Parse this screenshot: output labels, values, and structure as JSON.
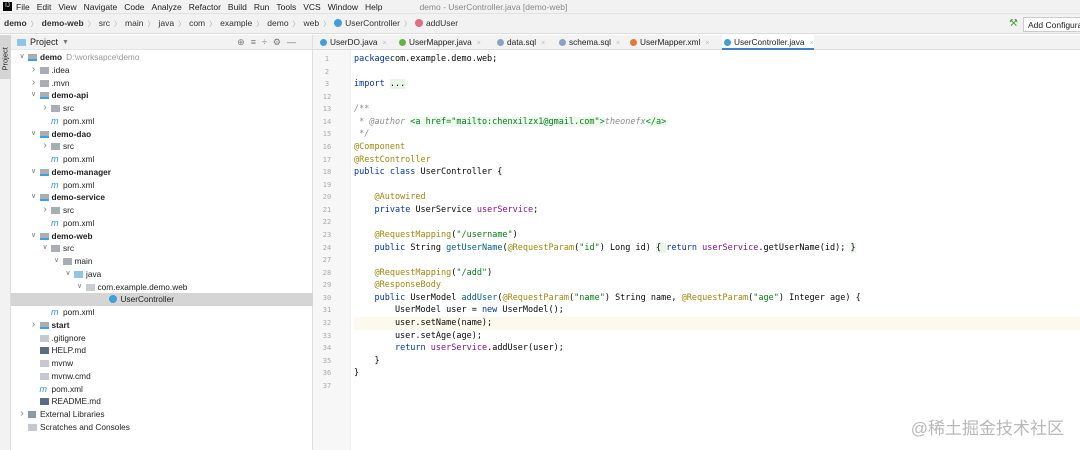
{
  "menubar": {
    "items": [
      "File",
      "Edit",
      "View",
      "Navigate",
      "Code",
      "Analyze",
      "Refactor",
      "Build",
      "Run",
      "Tools",
      "VCS",
      "Window",
      "Help"
    ],
    "title": "demo - UserController.java [demo-web]"
  },
  "breadcrumb": [
    "demo",
    "demo-web",
    "src",
    "main",
    "java",
    "com",
    "example",
    "demo",
    "web",
    "UserController",
    "addUser"
  ],
  "toolbar": {
    "add_config": "Add Configuration..."
  },
  "sidebar": {
    "vertical_tab": "Project",
    "panel_title": "Project"
  },
  "tree": [
    {
      "label": "demo",
      "hint": "D:\\worksapce\\demo",
      "level": 0,
      "arrow": "open",
      "icon": "mod",
      "bold": true
    },
    {
      "label": ".idea",
      "level": 1,
      "arrow": "closed",
      "icon": "dir"
    },
    {
      "label": ".mvn",
      "level": 1,
      "arrow": "closed",
      "icon": "dir"
    },
    {
      "label": "demo-api",
      "level": 1,
      "arrow": "open",
      "icon": "mod",
      "bold": true
    },
    {
      "label": "src",
      "level": 2,
      "arrow": "closed",
      "icon": "dir"
    },
    {
      "label": "pom.xml",
      "level": 2,
      "icon": "xml"
    },
    {
      "label": "demo-dao",
      "level": 1,
      "arrow": "open",
      "icon": "mod",
      "bold": true
    },
    {
      "label": "src",
      "level": 2,
      "arrow": "closed",
      "icon": "dir"
    },
    {
      "label": "pom.xml",
      "level": 2,
      "icon": "xml"
    },
    {
      "label": "demo-manager",
      "level": 1,
      "arrow": "open",
      "icon": "mod",
      "bold": true
    },
    {
      "label": "pom.xml",
      "level": 2,
      "icon": "xml"
    },
    {
      "label": "demo-service",
      "level": 1,
      "arrow": "open",
      "icon": "mod",
      "bold": true
    },
    {
      "label": "src",
      "level": 2,
      "arrow": "closed",
      "icon": "dir"
    },
    {
      "label": "pom.xml",
      "level": 2,
      "icon": "xml"
    },
    {
      "label": "demo-web",
      "level": 1,
      "arrow": "open",
      "icon": "mod",
      "bold": true
    },
    {
      "label": "src",
      "level": 2,
      "arrow": "open",
      "icon": "dir"
    },
    {
      "label": "main",
      "level": 3,
      "arrow": "open",
      "icon": "dir"
    },
    {
      "label": "java",
      "level": 4,
      "arrow": "open",
      "icon": "src"
    },
    {
      "label": "com.example.demo.web",
      "level": 5,
      "arrow": "open",
      "icon": "pkg"
    },
    {
      "label": "UserController",
      "level": 7,
      "icon": "cls",
      "selected": true
    },
    {
      "label": "pom.xml",
      "level": 2,
      "icon": "xml"
    },
    {
      "label": "start",
      "level": 1,
      "arrow": "closed",
      "icon": "mod",
      "bold": true
    },
    {
      "label": ".gitignore",
      "level": 1,
      "icon": "file"
    },
    {
      "label": "HELP.md",
      "level": 1,
      "icon": "md"
    },
    {
      "label": "mvnw",
      "level": 1,
      "icon": "file"
    },
    {
      "label": "mvnw.cmd",
      "level": 1,
      "icon": "file"
    },
    {
      "label": "pom.xml",
      "level": 1,
      "icon": "xml"
    },
    {
      "label": "README.md",
      "level": 1,
      "icon": "md"
    },
    {
      "label": "External Libraries",
      "level": 0,
      "arrow": "closed",
      "icon": "lib"
    },
    {
      "label": "Scratches and Consoles",
      "level": 0,
      "icon": "file"
    }
  ],
  "tabs": [
    {
      "label": "UserDO.java",
      "color": "#3f9fd6"
    },
    {
      "label": "UserMapper.java",
      "color": "#62b543"
    },
    {
      "label": "data.sql",
      "color": "#8aa4c0"
    },
    {
      "label": "schema.sql",
      "color": "#8aa4c0"
    },
    {
      "label": "UserMapper.xml",
      "color": "#e07a3a"
    },
    {
      "label": "UserController.java",
      "color": "#3f9fd6",
      "active": true
    }
  ],
  "code": [
    {
      "n": "1",
      "s": [
        [
          "kw",
          "package"
        ],
        [
          "",
          "com.example.demo.web;"
        ]
      ]
    },
    {
      "n": "2",
      "s": []
    },
    {
      "n": "3",
      "s": [
        [
          "kw",
          "import"
        ],
        [
          "",
          " "
        ],
        [
          "fo",
          "..."
        ]
      ]
    },
    {
      "n": "12",
      "s": []
    },
    {
      "n": "13",
      "s": [
        [
          "cm",
          "/**"
        ]
      ]
    },
    {
      "n": "14",
      "s": [
        [
          "cm",
          " * @author "
        ],
        [
          "tg",
          "<a href=\"mailto:chenxilzx1@gmail.com\">"
        ],
        [
          "cm",
          "theonefx"
        ],
        [
          "tg",
          "</a>"
        ]
      ]
    },
    {
      "n": "15",
      "s": [
        [
          "cm",
          " */"
        ]
      ]
    },
    {
      "n": "16",
      "s": [
        [
          "an",
          "@Component"
        ]
      ]
    },
    {
      "n": "17",
      "s": [
        [
          "an",
          "@RestController"
        ]
      ]
    },
    {
      "n": "18",
      "s": [
        [
          "kw",
          "public class "
        ],
        [
          "",
          "UserController {"
        ]
      ]
    },
    {
      "n": "19",
      "s": []
    },
    {
      "n": "20",
      "s": [
        [
          "",
          "    "
        ],
        [
          "an",
          "@Autowired"
        ]
      ]
    },
    {
      "n": "21",
      "s": [
        [
          "",
          "    "
        ],
        [
          "kw",
          "private "
        ],
        [
          "",
          "UserService "
        ],
        [
          "fd",
          "userService"
        ],
        [
          "",
          ";"
        ]
      ]
    },
    {
      "n": "22",
      "s": []
    },
    {
      "n": "23",
      "s": [
        [
          "",
          "    "
        ],
        [
          "an",
          "@RequestMapping"
        ],
        [
          "",
          "("
        ],
        [
          "st",
          "\"/username\""
        ],
        [
          "",
          ")"
        ]
      ]
    },
    {
      "n": "24",
      "s": [
        [
          "",
          "    "
        ],
        [
          "kw",
          "public "
        ],
        [
          "",
          "String "
        ],
        [
          "md",
          "getUserName"
        ],
        [
          "",
          "("
        ],
        [
          "an",
          "@RequestParam"
        ],
        [
          "",
          "("
        ],
        [
          "st",
          "\"id\""
        ],
        [
          "",
          ") Long id) "
        ],
        [
          "fo",
          "{ "
        ],
        [
          "kw",
          "return "
        ],
        [
          "fd",
          "userService"
        ],
        [
          "",
          ".getUserName(id); "
        ],
        [
          "fo",
          "}"
        ]
      ]
    },
    {
      "n": "27",
      "s": []
    },
    {
      "n": "28",
      "s": [
        [
          "",
          "    "
        ],
        [
          "an",
          "@RequestMapping"
        ],
        [
          "",
          "("
        ],
        [
          "st",
          "\"/add\""
        ],
        [
          "",
          ")"
        ]
      ]
    },
    {
      "n": "29",
      "s": [
        [
          "",
          "    "
        ],
        [
          "an",
          "@ResponseBody"
        ]
      ]
    },
    {
      "n": "30",
      "s": [
        [
          "",
          "    "
        ],
        [
          "kw",
          "public "
        ],
        [
          "",
          "UserModel "
        ],
        [
          "md",
          "addUser"
        ],
        [
          "",
          "("
        ],
        [
          "an",
          "@RequestParam"
        ],
        [
          "",
          "("
        ],
        [
          "st",
          "\"name\""
        ],
        [
          "",
          ") String name, "
        ],
        [
          "an",
          "@RequestParam"
        ],
        [
          "",
          "("
        ],
        [
          "st",
          "\"age\""
        ],
        [
          "",
          ") Integer age) {"
        ]
      ]
    },
    {
      "n": "31",
      "s": [
        [
          "",
          "        UserModel user = "
        ],
        [
          "kw",
          "new "
        ],
        [
          "",
          "UserModel();"
        ]
      ]
    },
    {
      "n": "32",
      "s": [
        [
          "",
          "        user.setName(name);"
        ]
      ],
      "current": true
    },
    {
      "n": "33",
      "s": [
        [
          "",
          "        user.setAge(age);"
        ]
      ]
    },
    {
      "n": "34",
      "s": [
        [
          "",
          "        "
        ],
        [
          "kw",
          "return "
        ],
        [
          "fd",
          "userService"
        ],
        [
          "",
          ".addUser(user);"
        ]
      ]
    },
    {
      "n": "35",
      "s": [
        [
          "",
          "    }"
        ]
      ]
    },
    {
      "n": "36",
      "s": [
        [
          "",
          "}"
        ]
      ]
    },
    {
      "n": "37",
      "s": []
    }
  ],
  "watermark": "@稀土掘金技术社区"
}
